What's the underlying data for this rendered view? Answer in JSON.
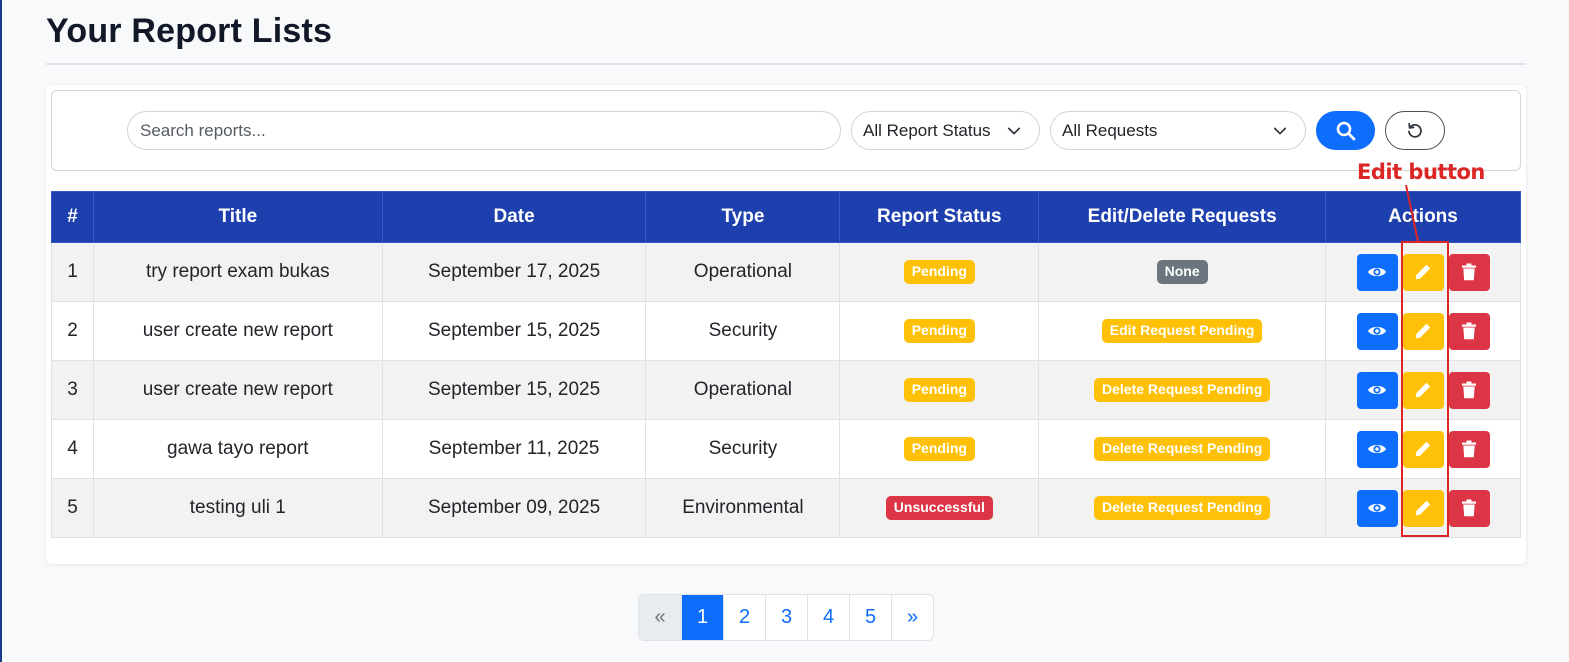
{
  "page": {
    "title": "Your Report Lists"
  },
  "filters": {
    "search_placeholder": "Search reports...",
    "status_select": "All Report Status",
    "requests_select": "All Requests"
  },
  "table": {
    "headers": [
      "#",
      "Title",
      "Date",
      "Type",
      "Report Status",
      "Edit/Delete Requests",
      "Actions"
    ],
    "rows": [
      {
        "num": "1",
        "title": "try report exam bukas",
        "date": "September 17, 2025",
        "type": "Operational",
        "status": "Pending",
        "status_kind": "pending",
        "request": "None",
        "request_kind": "none"
      },
      {
        "num": "2",
        "title": "user create new report",
        "date": "September 15, 2025",
        "type": "Security",
        "status": "Pending",
        "status_kind": "pending",
        "request": "Edit Request Pending",
        "request_kind": "pending"
      },
      {
        "num": "3",
        "title": "user create new report",
        "date": "September 15, 2025",
        "type": "Operational",
        "status": "Pending",
        "status_kind": "pending",
        "request": "Delete Request Pending",
        "request_kind": "pending"
      },
      {
        "num": "4",
        "title": "gawa tayo report",
        "date": "September 11, 2025",
        "type": "Security",
        "status": "Pending",
        "status_kind": "pending",
        "request": "Delete Request Pending",
        "request_kind": "pending"
      },
      {
        "num": "5",
        "title": "testing uli 1",
        "date": "September 09, 2025",
        "type": "Environmental",
        "status": "Unsuccessful",
        "status_kind": "unsuccessful",
        "request": "Delete Request Pending",
        "request_kind": "pending"
      }
    ]
  },
  "annotation": {
    "label": "Edit button",
    "color": "#dc2626"
  },
  "pagination": {
    "prev": "«",
    "pages": [
      "1",
      "2",
      "3",
      "4",
      "5"
    ],
    "active": "1",
    "next": "»"
  },
  "colors": {
    "header_bg": "#1e40af",
    "primary": "#0d6efd",
    "warning": "#ffc107",
    "danger": "#dc3545",
    "secondary": "#6c757d"
  },
  "icons": {
    "select_chevron": "chevron-down-icon",
    "search_button": "search-icon",
    "reset_button": "reset-icon",
    "view": "eye-icon",
    "edit": "pencil-icon",
    "delete": "trash-icon"
  }
}
